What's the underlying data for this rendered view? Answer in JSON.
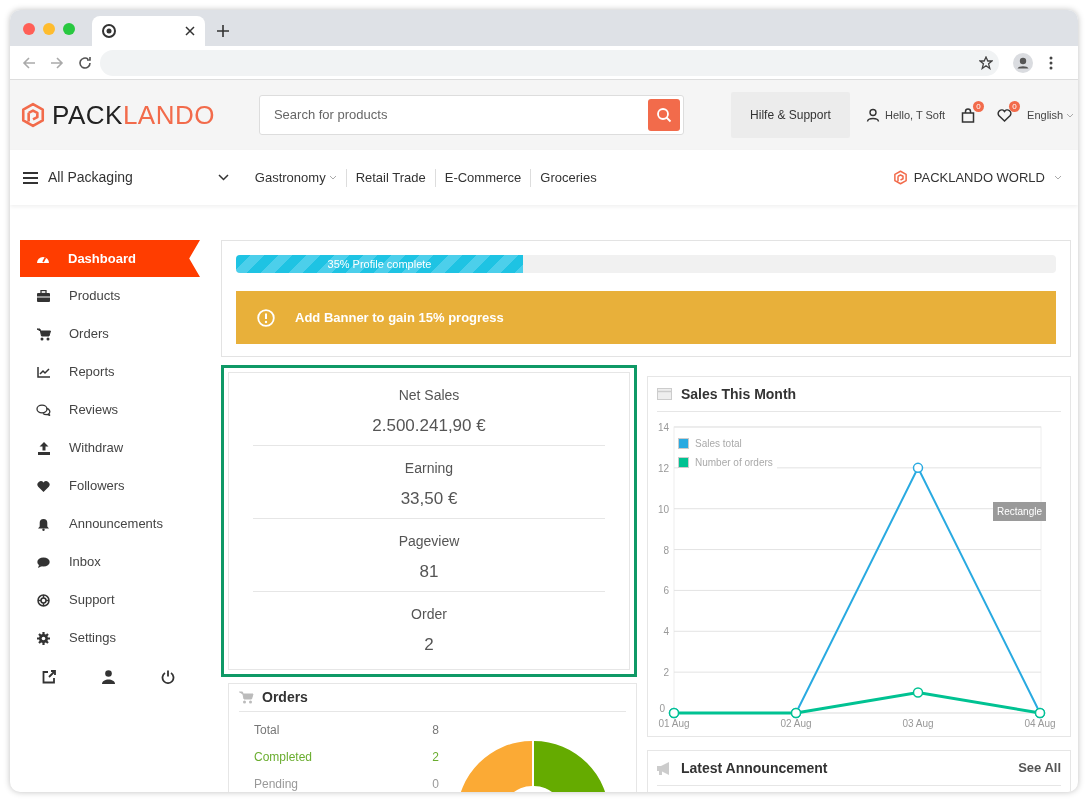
{
  "header": {
    "logo": {
      "part_1": "PACK",
      "part_2": "LANDO"
    },
    "search": {
      "placeholder": "Search for products"
    },
    "support_button": "Hilfe & Support",
    "user_greeting": "Hello, T Soft",
    "cart_badge": "0",
    "wishlist_badge": "0",
    "language": "English"
  },
  "nav": {
    "menu_label": "All Packaging",
    "items": [
      {
        "label": "Gastronomy",
        "has_dropdown": true
      },
      {
        "label": "Retail Trade",
        "has_dropdown": false
      },
      {
        "label": "E-Commerce",
        "has_dropdown": false
      },
      {
        "label": "Groceries",
        "has_dropdown": false
      }
    ],
    "world_link": "PACKLANDO WORLD"
  },
  "sidebar": {
    "items": [
      {
        "label": "Dashboard",
        "selected": true
      },
      {
        "label": "Products",
        "selected": false
      },
      {
        "label": "Orders",
        "selected": false
      },
      {
        "label": "Reports",
        "selected": false
      },
      {
        "label": "Reviews",
        "selected": false
      },
      {
        "label": "Withdraw",
        "selected": false
      },
      {
        "label": "Followers",
        "selected": false
      },
      {
        "label": "Announcements",
        "selected": false
      },
      {
        "label": "Inbox",
        "selected": false
      },
      {
        "label": "Support",
        "selected": false
      },
      {
        "label": "Settings",
        "selected": false
      }
    ]
  },
  "profile_progress": {
    "label": "35% Profile complete",
    "level": 0.35
  },
  "alert": "Add Banner to gain 15% progress",
  "stats": [
    {
      "label": "Net Sales",
      "value": "2.500.241,90 €"
    },
    {
      "label": "Earning",
      "value": "33,50 €"
    },
    {
      "label": "Pageview",
      "value": "81"
    },
    {
      "label": "Order",
      "value": "2"
    }
  ],
  "orders": {
    "title": "Orders",
    "rows": [
      {
        "label": "Total",
        "value": "8",
        "color": "#777777"
      },
      {
        "label": "Completed",
        "value": "2",
        "color": "#6aad2f"
      },
      {
        "label": "Pending",
        "value": "0",
        "color": "#999999"
      }
    ]
  },
  "sales_chart": {
    "title": "Sales This Month",
    "overlay_label": "Rectangle",
    "chart_data": {
      "type": "line",
      "categories": [
        "01 Aug",
        "02 Aug",
        "03 Aug",
        "04 Aug"
      ],
      "series": [
        {
          "name": "Sales total",
          "color": "#29aae1",
          "marker": "circle",
          "values": [
            0,
            0,
            12,
            0
          ]
        },
        {
          "name": "Number of orders",
          "color": "#00c292",
          "marker": "circle",
          "values": [
            0,
            0,
            1,
            0
          ]
        }
      ],
      "grid": true,
      "legend": true,
      "ylim": [
        0,
        14
      ],
      "yticks": [
        {
          "value": 0,
          "label": "0"
        },
        {
          "value": 2,
          "label": "2"
        },
        {
          "value": 4,
          "label": "4"
        },
        {
          "value": 6,
          "label": "6"
        },
        {
          "value": 8,
          "label": "8"
        },
        {
          "value": 10,
          "label": "10"
        },
        {
          "value": 12,
          "label": "12"
        },
        {
          "value": 14,
          "label": "14"
        }
      ]
    }
  },
  "announcements": {
    "title": "Latest Announcement",
    "see_all": "See All"
  }
}
